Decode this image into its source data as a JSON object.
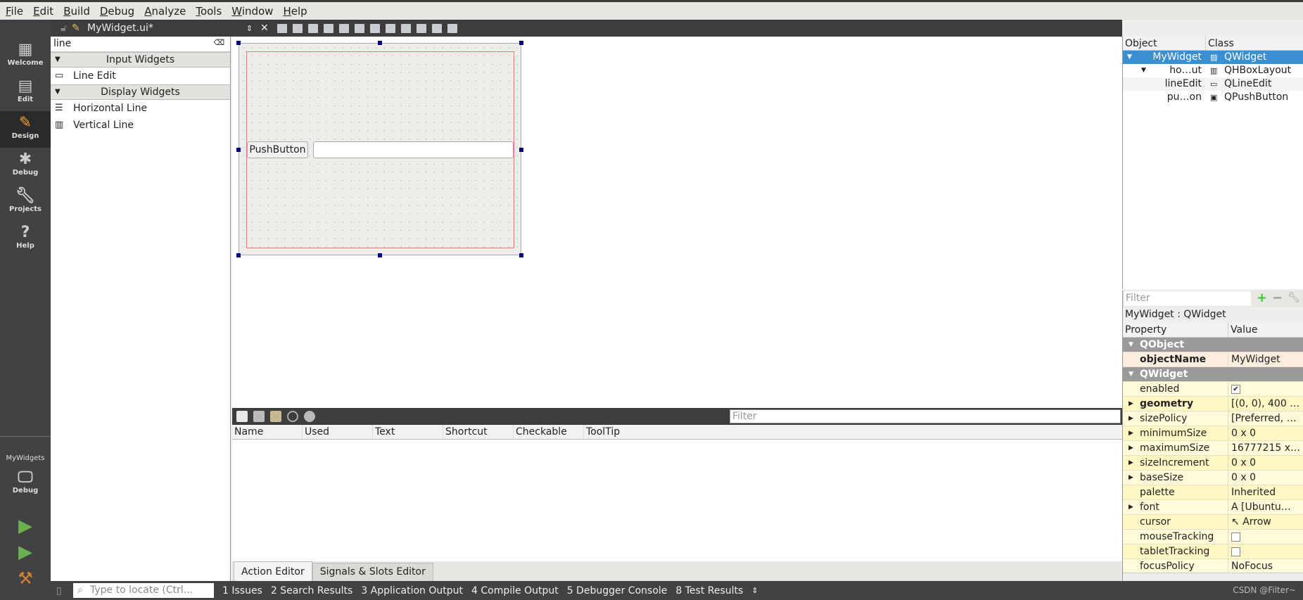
{
  "menu": [
    "File",
    "Edit",
    "Build",
    "Debug",
    "Analyze",
    "Tools",
    "Window",
    "Help"
  ],
  "modes": [
    {
      "label": "Welcome",
      "icon": "grid-icon"
    },
    {
      "label": "Edit",
      "icon": "document-icon"
    },
    {
      "label": "Design",
      "icon": "pencil-icon",
      "selected": true
    },
    {
      "label": "Debug",
      "icon": "bug-icon"
    },
    {
      "label": "Projects",
      "icon": "wrench-icon"
    },
    {
      "label": "Help",
      "icon": "help-icon"
    }
  ],
  "kit": {
    "project": "MyWidgets",
    "config": "Debug"
  },
  "document": {
    "title": "MyWidget.ui*"
  },
  "widget_box": {
    "search": "line",
    "categories": [
      {
        "name": "Input Widgets",
        "items": [
          "Line Edit"
        ]
      },
      {
        "name": "Display Widgets",
        "items": [
          "Horizontal Line",
          "Vertical Line"
        ]
      }
    ]
  },
  "form": {
    "button_text": "PushButton",
    "line_edit_value": ""
  },
  "action_editor": {
    "filter_placeholder": "Filter",
    "columns": [
      "Name",
      "Used",
      "Text",
      "Shortcut",
      "Checkable",
      "ToolTip"
    ]
  },
  "editor_tabs": [
    "Action Editor",
    "Signals & Slots Editor"
  ],
  "object_inspector": {
    "columns": [
      "Object",
      "Class"
    ],
    "rows": [
      {
        "object": "MyWidget",
        "class": "QWidget"
      },
      {
        "object": "ho…ut",
        "class": "QHBoxLayout"
      },
      {
        "object": "lineEdit",
        "class": "QLineEdit"
      },
      {
        "object": "pu…on",
        "class": "QPushButton"
      }
    ]
  },
  "property_editor": {
    "filter_placeholder": "Filter",
    "title": "MyWidget : QWidget",
    "columns": [
      "Property",
      "Value"
    ],
    "groups": [
      {
        "name": "QObject",
        "props": [
          {
            "name": "objectName",
            "value": "MyWidget"
          }
        ]
      },
      {
        "name": "QWidget",
        "props": [
          {
            "name": "enabled",
            "checked": true
          },
          {
            "name": "geometry",
            "value": "[(0, 0), 400 …"
          },
          {
            "name": "sizePolicy",
            "value": "[Preferred, …"
          },
          {
            "name": "minimumSize",
            "value": "0 x 0"
          },
          {
            "name": "maximumSize",
            "value": "16777215 x…"
          },
          {
            "name": "sizeIncrement",
            "value": "0 x 0"
          },
          {
            "name": "baseSize",
            "value": "0 x 0"
          },
          {
            "name": "palette",
            "value": "Inherited"
          },
          {
            "name": "font",
            "value": "[Ubuntu…"
          },
          {
            "name": "cursor",
            "value": "Arrow"
          },
          {
            "name": "mouseTracking",
            "checked": false
          },
          {
            "name": "tabletTracking",
            "checked": false
          },
          {
            "name": "focusPolicy",
            "value": "NoFocus"
          }
        ]
      }
    ]
  },
  "statusbar": {
    "locate_placeholder": "Type to locate (Ctrl...",
    "panes": [
      "1  Issues",
      "2  Search Results",
      "3  Application Output",
      "4  Compile Output",
      "5  Debugger Console",
      "8  Test Results"
    ],
    "watermark": "CSDN @Filter~"
  }
}
